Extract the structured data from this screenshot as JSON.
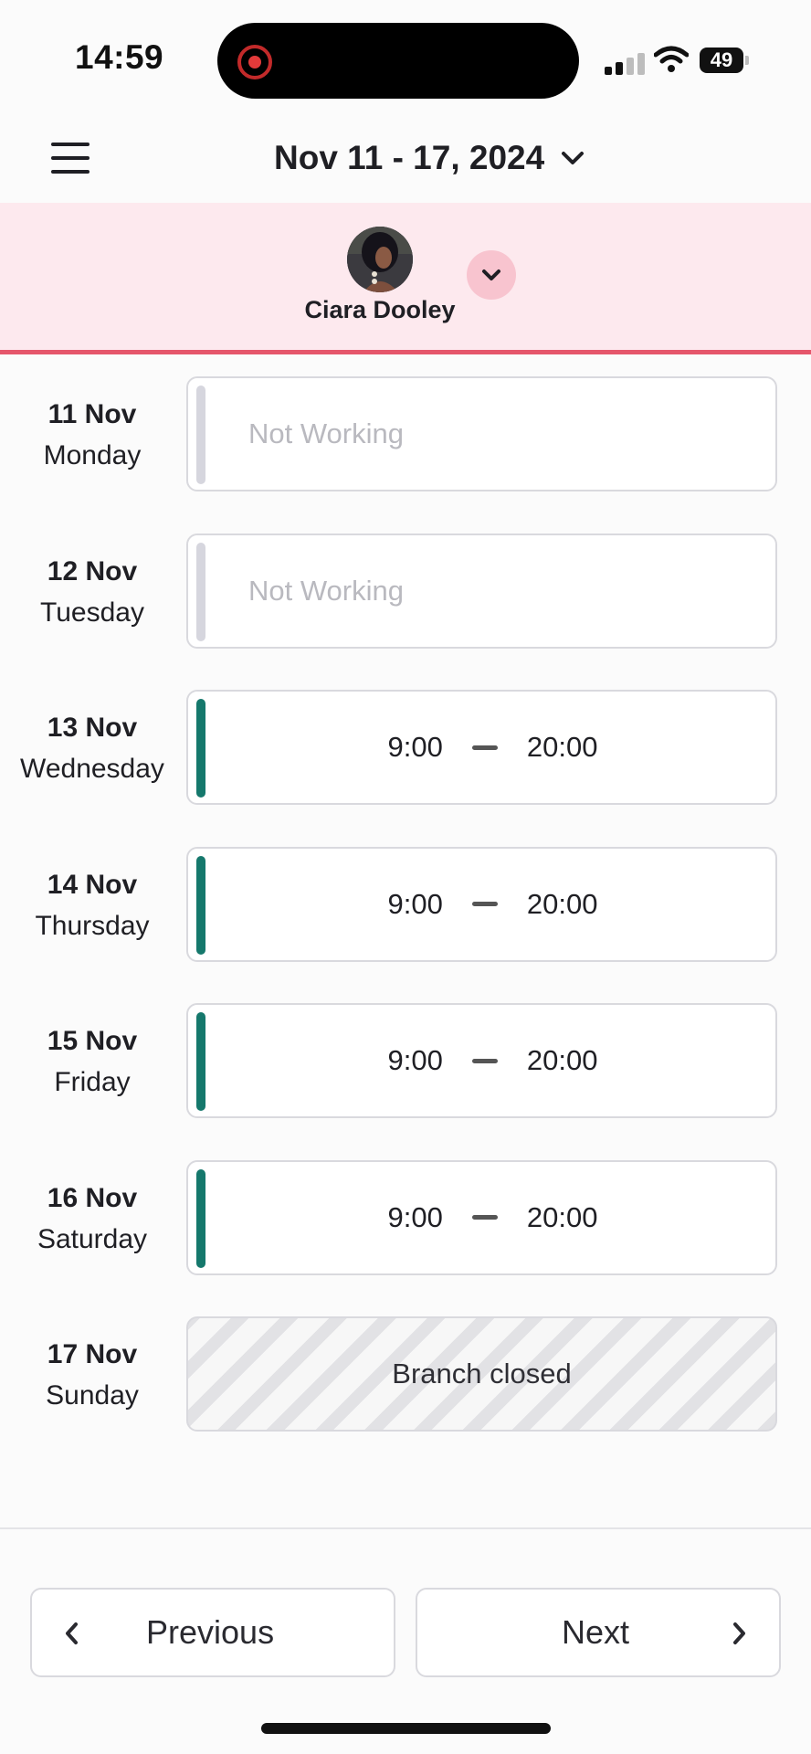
{
  "status_bar": {
    "time": "14:59",
    "battery": "49",
    "icons": [
      "recording-icon",
      "signal-icon",
      "wifi-icon",
      "battery-icon"
    ]
  },
  "header": {
    "menu_icon": "hamburger-menu-icon",
    "week_range": "Nov 11 - 17, 2024",
    "dropdown_icon": "chevron-down-icon"
  },
  "staff": {
    "name": "Ciara Dooley",
    "toggle_icon": "chevron-down-icon"
  },
  "days": [
    {
      "date": "11 Nov",
      "weekday": "Monday",
      "status": "off",
      "text": "Not Working"
    },
    {
      "date": "12 Nov",
      "weekday": "Tuesday",
      "status": "off",
      "text": "Not Working"
    },
    {
      "date": "13 Nov",
      "weekday": "Wednesday",
      "status": "working",
      "start": "9:00",
      "end": "20:00"
    },
    {
      "date": "14 Nov",
      "weekday": "Thursday",
      "status": "working",
      "start": "9:00",
      "end": "20:00"
    },
    {
      "date": "15 Nov",
      "weekday": "Friday",
      "status": "working",
      "start": "9:00",
      "end": "20:00"
    },
    {
      "date": "16 Nov",
      "weekday": "Saturday",
      "status": "working",
      "start": "9:00",
      "end": "20:00"
    },
    {
      "date": "17 Nov",
      "weekday": "Sunday",
      "status": "closed",
      "text": "Branch closed"
    }
  ],
  "footer": {
    "previous_label": "Previous",
    "next_label": "Next"
  },
  "colors": {
    "accent_red": "#e5566b",
    "staff_band_bg": "#fde9ee",
    "working_bar": "#15786c",
    "off_bar": "#d6d6de"
  }
}
